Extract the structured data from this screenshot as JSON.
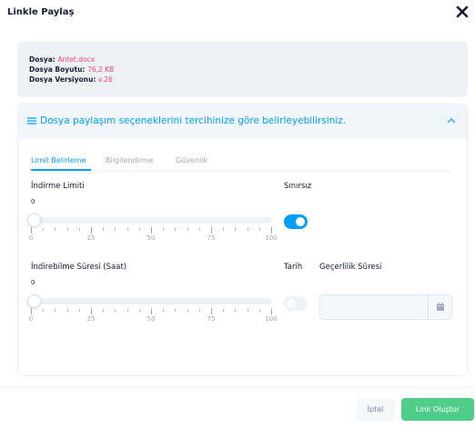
{
  "modal": {
    "title": "Linkle Paylaş"
  },
  "file": {
    "name_label": "Dosya:",
    "name_value": "Antet.docx",
    "size_label": "Dosya Boyutu:",
    "size_value": "76,2 KB",
    "version_label": "Dosya Versiyonu:",
    "version_value": "v.26"
  },
  "card": {
    "header_text": "Dosya paylaşım seçeneklerini tercihinize göre belirleyebilirsiniz."
  },
  "tabs": [
    {
      "label": "Limit Belirleme",
      "active": true
    },
    {
      "label": "Bilgilendirme",
      "active": false
    },
    {
      "label": "Güvenlik",
      "active": false
    }
  ],
  "download_limit": {
    "label": "İndirme Limiti",
    "value": 0,
    "min": 0,
    "max": 100,
    "ticks": [
      "0",
      "25",
      "50",
      "75",
      "100"
    ]
  },
  "unlimited": {
    "label": "Sınırsız",
    "on": true
  },
  "download_duration": {
    "label": "İndirebilme Süresi (Saat)",
    "value": 0,
    "min": 0,
    "max": 100,
    "ticks": [
      "0",
      "25",
      "50",
      "75",
      "100"
    ]
  },
  "date": {
    "label": "Tarih",
    "on": false
  },
  "validity": {
    "label": "Geçerlilik Süresi",
    "value": ""
  },
  "buttons": {
    "cancel": "İptal",
    "create": "Link Oluştur"
  },
  "colors": {
    "primary": "#009ef7",
    "success": "#50cd89",
    "danger": "#f1416c"
  }
}
